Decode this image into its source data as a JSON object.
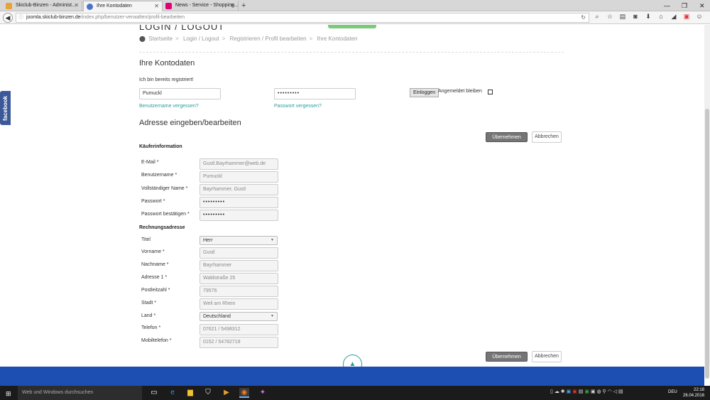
{
  "browser": {
    "tabs": [
      {
        "label": "Skiclub-Binzen - Administ...",
        "color": "#e8a23a"
      },
      {
        "label": "Ihre Kontodaten",
        "color": "#4a74c9"
      },
      {
        "label": "News - Service - Shopping...",
        "color": "#e20074"
      }
    ],
    "url_host": "joomla.skiclub-binzen.de",
    "url_path": "/index.php/benutzer-verwalten/profil-bearbeiten"
  },
  "page": {
    "heading": "LOGIN / LOGOUT",
    "breadcrumb": [
      "Startseite",
      "Login / Logout",
      "Registrieren / Profil bearbeiten",
      "Ihre Kontodaten"
    ],
    "account_title": "Ihre Kontodaten",
    "registered_text": "Ich bin bereits registriert!",
    "username_value": "Pumuckl",
    "password_value": "•••••••••",
    "login_button": "Einloggen",
    "remember_label": "Angemeldet bleiben",
    "forgot_username": "Benutzername vergessen?",
    "forgot_password": "Passwort vergessen?",
    "address_title": "Adresse eingeben/bearbeiten",
    "submit_button": "Übernehmen",
    "cancel_button": "Abbrechen",
    "buyer_section": "Käuferinformation",
    "billing_section": "Rechnungsadresse",
    "buyer_fields": [
      {
        "label": "E-Mail *",
        "value": "Gustl.Bayrhammer@web.de"
      },
      {
        "label": "Benutzername *",
        "value": "Pumuckl"
      },
      {
        "label": "Vollständiger Name *",
        "value": "Bayrhammer, Gustl"
      },
      {
        "label": "Passwort *",
        "value": "•••••••••"
      },
      {
        "label": "Passwort bestätigen *",
        "value": "•••••••••"
      }
    ],
    "billing_fields": {
      "titel": {
        "label": "Titel",
        "value": "Herr"
      },
      "vorname": {
        "label": "Vorname *",
        "value": "Gustl"
      },
      "nachname": {
        "label": "Nachname *",
        "value": "Bayrhammer"
      },
      "adresse": {
        "label": "Adresse 1 *",
        "value": "Waldstraße 25"
      },
      "plz": {
        "label": "Postleitzahl *",
        "value": "79576"
      },
      "stadt": {
        "label": "Stadt *",
        "value": "Weil am Rhein"
      },
      "land": {
        "label": "Land *",
        "value": "Deutschland"
      },
      "telefon": {
        "label": "Telefon *",
        "value": "07621 / 5498312"
      },
      "mobil": {
        "label": "Mobiltelefon *",
        "value": "0152 / 54782719"
      }
    },
    "facebook_label": "facebook"
  },
  "taskbar": {
    "search_placeholder": "Web und Windows durchsuchen",
    "language": "DEU",
    "time": "22:18",
    "date": "26.04.2016"
  }
}
